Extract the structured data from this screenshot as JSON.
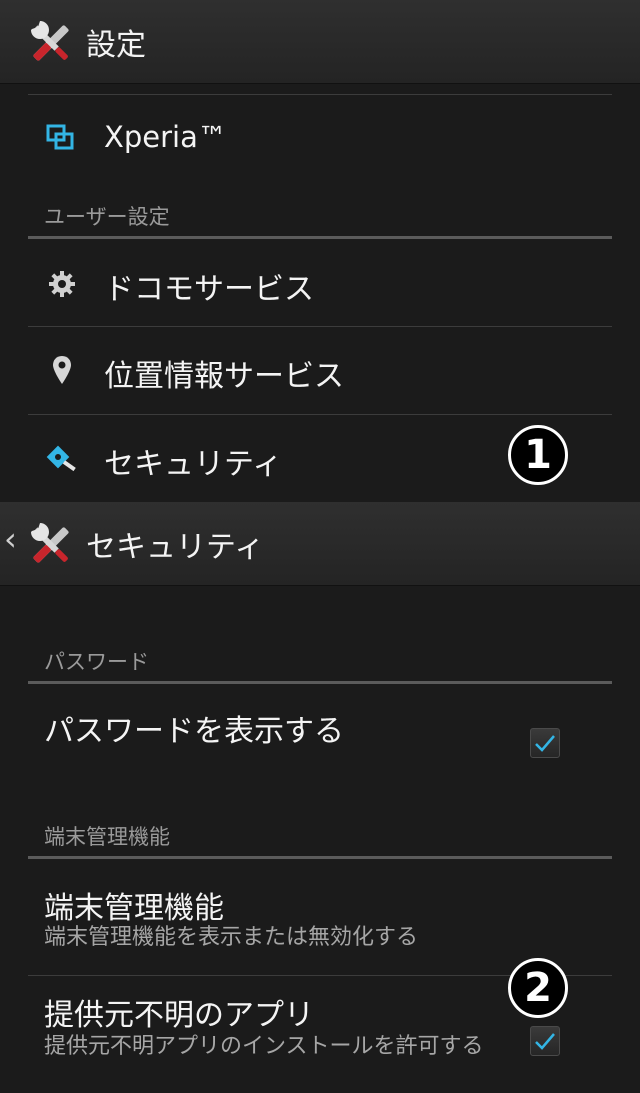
{
  "screen1": {
    "title": "設定",
    "xperia_label": "Xperia™",
    "section_user": "ユーザー設定",
    "items": [
      {
        "label": "ドコモサービス",
        "icon": "gear-icon"
      },
      {
        "label": "位置情報サービス",
        "icon": "location-pin-icon"
      },
      {
        "label": "セキュリティ",
        "icon": "security-key-icon"
      }
    ],
    "marker": "1"
  },
  "screen2": {
    "back": "‹",
    "title": "セキュリティ",
    "section_password": "パスワード",
    "show_password": {
      "label": "パスワードを表示する",
      "checked": true
    },
    "section_device_admin": "端末管理機能",
    "device_admin": {
      "label": "端末管理機能",
      "summary": "端末管理機能を表示または無効化する"
    },
    "unknown_sources": {
      "label": "提供元不明のアプリ",
      "summary": "提供元不明アプリのインストールを許可する",
      "checked": true
    },
    "marker": "2"
  },
  "colors": {
    "accent_check": "#33b5e5",
    "icon_blue": "#33b5e5"
  }
}
